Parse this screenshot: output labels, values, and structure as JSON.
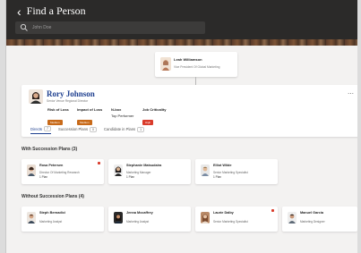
{
  "header": {
    "title": "Find a Person",
    "search_value": "John Doe"
  },
  "manager": {
    "name": "Leah Williamson",
    "role": "Vice President Of Global Marketing"
  },
  "profile": {
    "name": "Rory Johnson",
    "title": "Senior Venue Regional Director",
    "metrics": [
      {
        "label": "Risk of Loss",
        "badge": "Medium",
        "badge_color": "#c86a19"
      },
      {
        "label": "Impact of Loss",
        "badge": "Medium",
        "badge_color": "#c86a19"
      },
      {
        "label": "N-box",
        "value": "Top Performer"
      },
      {
        "label": "Job Criticality",
        "badge": "High",
        "badge_color": "#d93b2b"
      }
    ],
    "tabs": [
      {
        "label": "Directs",
        "count": "7"
      },
      {
        "label": "Succession Plans",
        "count": "0"
      },
      {
        "label": "Candidate in Plans",
        "count": "1"
      }
    ]
  },
  "with_plans": {
    "title": "With Succession Plans (3)",
    "cards": [
      {
        "name": "Rosa Petersen",
        "role": "Director Of Marketing Research",
        "plan": "1 Plan",
        "flag": true
      },
      {
        "name": "Stephanie Matsudaira",
        "role": "Marketing Manager",
        "plan": "1 Plan",
        "flag": false
      },
      {
        "name": "Elliot Wilde",
        "role": "Senior Marketing Specialist",
        "plan": "1 Plan",
        "flag": false
      }
    ]
  },
  "without_plans": {
    "title": "Without Succession Plans (4)",
    "cards": [
      {
        "name": "Steph Bernadici",
        "role": "Marketing Analyst",
        "flag": false
      },
      {
        "name": "Jenna Mccaffrey",
        "role": "Marketing Analyst",
        "flag": false
      },
      {
        "name": "Laurie Dalby",
        "role": "Senior Marketing Specialist",
        "flag": true
      },
      {
        "name": "Manuel Garcia",
        "role": "Marketing Designer",
        "flag": false
      }
    ]
  }
}
